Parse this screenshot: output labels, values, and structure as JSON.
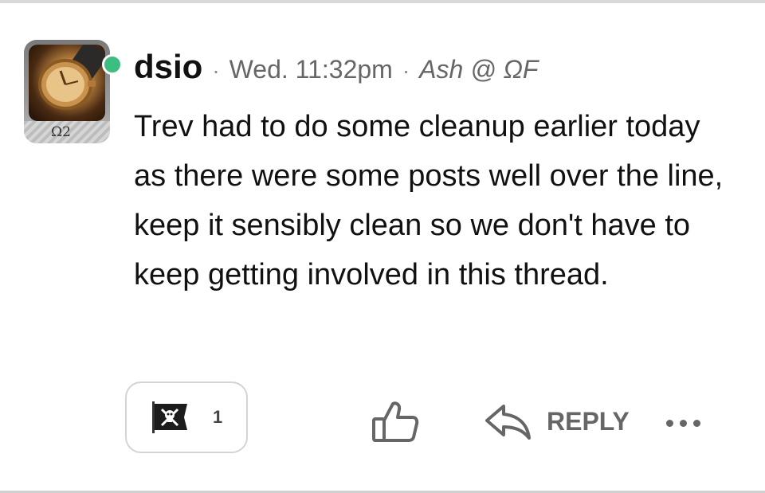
{
  "post": {
    "author": "dsio",
    "separator": "·",
    "timestamp": "Wed. 11:32pm",
    "community": "Ash @ ΩF",
    "avatar": {
      "rank_badge": "Ω2",
      "online": true,
      "status_color": "#3dbd7f"
    },
    "body": "Trev had to do some cleanup earlier today as there were some posts well over the line, keep it sensibly clean so we don't have to keep getting involved in this thread."
  },
  "actions": {
    "reaction": {
      "icon": "pirate-flag-icon",
      "count": "1"
    },
    "like_icon": "thumbs-up-icon",
    "reply_icon": "reply-arrow-icon",
    "reply_label": "REPLY",
    "more_icon": "more-dots-icon"
  }
}
